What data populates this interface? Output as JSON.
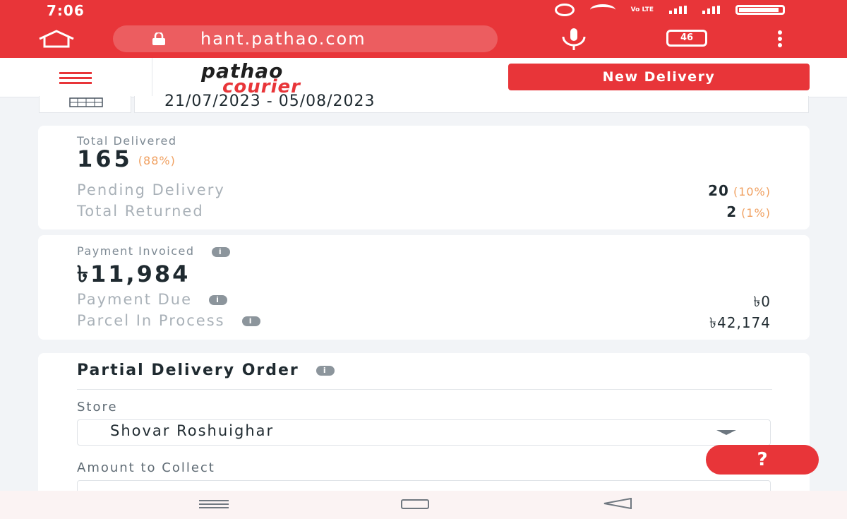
{
  "status_bar": {
    "time": "7:06",
    "network_label": "Vo LTE",
    "icons": [
      "alarm-icon",
      "wifi-icon",
      "signal-icon",
      "battery-icon"
    ]
  },
  "browser": {
    "url": "hant.pathao.com",
    "tab_count": "46",
    "icons": [
      "home-icon",
      "lock-icon",
      "mic-icon",
      "tabs-icon",
      "more-icon"
    ]
  },
  "header": {
    "logo_line1": "pathao",
    "logo_line2": "courier",
    "new_delivery_label": "New Delivery",
    "brand_color": "#e83539"
  },
  "filter": {
    "date_range": "21/07/2023 - 05/08/2023"
  },
  "delivery_summary": {
    "total_delivered_label": "Total Delivered",
    "total_delivered_value": "165",
    "total_delivered_pct": "(88%)",
    "pending_label": "Pending Delivery",
    "pending_value": "20",
    "pending_pct": "(10%)",
    "returned_label": "Total Returned",
    "returned_value": "2",
    "returned_pct": "(1%)"
  },
  "payment_summary": {
    "invoiced_label": "Payment Invoiced",
    "invoiced_value": "৳11,984",
    "due_label": "Payment Due",
    "due_value": "৳0",
    "in_process_label": "Parcel In Process",
    "in_process_value": "৳42,174"
  },
  "partial_delivery": {
    "title": "Partial Delivery Order",
    "store_label": "Store",
    "store_value": "Shovar Roshuighar",
    "amount_label": "Amount to Collect"
  },
  "help_button_label": "?"
}
